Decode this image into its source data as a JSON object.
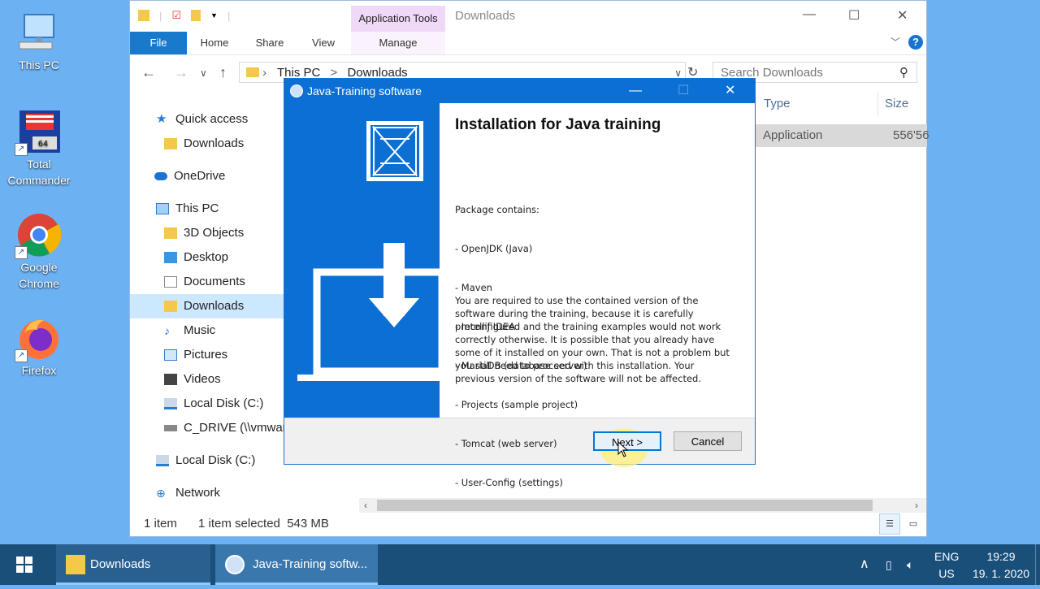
{
  "desktop": {
    "icons": [
      {
        "label": "This PC"
      },
      {
        "label": "Total Commander"
      },
      {
        "label": "Google Chrome"
      },
      {
        "label": "Firefox"
      }
    ]
  },
  "explorer": {
    "app_tools_label": "Application Tools",
    "title": "Downloads",
    "tabs": {
      "file": "File",
      "home": "Home",
      "share": "Share",
      "view": "View",
      "manage": "Manage"
    },
    "address": {
      "root": "This PC",
      "sep": ">",
      "current": "Downloads"
    },
    "search_placeholder": "Search Downloads",
    "nav": {
      "quick_access": "Quick access",
      "qa_downloads": "Downloads",
      "onedrive": "OneDrive",
      "this_pc": "This PC",
      "objects3d": "3D Objects",
      "desktop": "Desktop",
      "documents": "Documents",
      "downloads": "Downloads",
      "music": "Music",
      "pictures": "Pictures",
      "videos": "Videos",
      "local_disk_c": "Local Disk (C:)",
      "c_drive": "C_DRIVE (\\\\vmware",
      "local_disk_c2": "Local Disk (C:)",
      "network": "Network"
    },
    "columns": {
      "type": "Type",
      "size": "Size"
    },
    "file": {
      "type": "Application",
      "size": "556'56"
    },
    "status": {
      "count": "1 item",
      "selected": "1 item selected  543 MB"
    }
  },
  "dialog": {
    "title": "Java-Training software",
    "heading": "Installation for Java training",
    "package_lines": [
      "Package contains:",
      "- OpenJDK (Java)",
      "- Maven",
      "- IntelliJ IDEA",
      "- MariaDB (database server)",
      "- Projects (sample project)",
      "- Tomcat (web server)",
      "- User-Config (settings)"
    ],
    "paragraph": "You are required to use the contained version of the software during the training, because it is carefully preconfigured and the training examples would not work correctly otherwise. It is possible that you already have some of it installed on your own. That is not a problem but you still need to proceed with this installation. Your previous version of the software will not be affected.",
    "next_label": "Next >",
    "cancel_label": "Cancel"
  },
  "taskbar": {
    "items": [
      {
        "label": "Downloads"
      },
      {
        "label": "Java-Training softw..."
      }
    ],
    "lang_top": "ENG",
    "lang_bottom": "US",
    "time": "19:29",
    "date": "19. 1. 2020"
  },
  "colors": {
    "desktop": "#6cb1f2",
    "accent": "#0b6fd4",
    "taskbar": "#1a4f7a",
    "app_tools": "#f0d9f8"
  }
}
